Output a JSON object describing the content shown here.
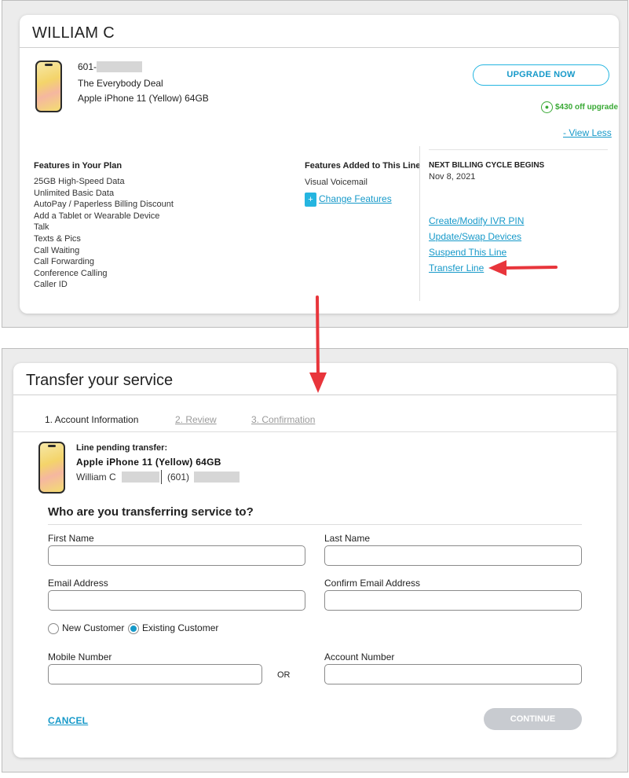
{
  "line_card": {
    "owner_name": "WILLIAM C",
    "line_number_prefix": "601-",
    "plan_name": "The Everybody Deal",
    "device": "Apple iPhone 11 (Yellow) 64GB",
    "upgrade_button": "UPGRADE NOW",
    "promo_badge": "$430 off upgrade",
    "view_less_link": "- View Less",
    "features_in_plan_heading": "Features in Your Plan",
    "features_in_plan": [
      "25GB High-Speed Data",
      "Unlimited Basic Data",
      "AutoPay / Paperless Billing Discount",
      "Add a Tablet or Wearable Device",
      "Talk",
      "Texts & Pics",
      "Call Waiting",
      "Call Forwarding",
      "Conference Calling",
      "Caller ID"
    ],
    "features_added_heading": "Features Added to This Line",
    "features_added": [
      "Visual Voicemail"
    ],
    "change_features_link": "Change Features",
    "change_features_plus": "+",
    "billing_label": "NEXT BILLING CYCLE BEGINS",
    "billing_date": "Nov 8, 2021",
    "actions": [
      "Create/Modify IVR PIN",
      "Update/Swap Devices",
      "Suspend This Line",
      "Transfer Line"
    ]
  },
  "transfer_card": {
    "title": "Transfer your service",
    "steps": [
      {
        "label": "1. Account Information",
        "active": true
      },
      {
        "label": "2. Review",
        "active": false
      },
      {
        "label": "3. Confirmation",
        "active": false
      }
    ],
    "pending_label": "Line pending transfer:",
    "pending_device": "Apple iPhone 11 (Yellow) 64GB",
    "pending_owner": "William C",
    "pending_area_code": "(601)",
    "question": "Who are you transferring service to?",
    "fields": {
      "first_name": {
        "label": "First Name",
        "value": ""
      },
      "last_name": {
        "label": "Last Name",
        "value": ""
      },
      "email": {
        "label": "Email Address",
        "value": ""
      },
      "confirm_email": {
        "label": "Confirm Email Address",
        "value": ""
      },
      "mobile_number": {
        "label": "Mobile Number",
        "value": ""
      },
      "account_number": {
        "label": "Account Number",
        "value": ""
      }
    },
    "customer_type": {
      "options": [
        "New Customer",
        "Existing Customer"
      ],
      "selected": "Existing Customer"
    },
    "or_label": "OR",
    "cancel_link": "CANCEL",
    "continue_button": "CONTINUE",
    "continue_enabled": false
  },
  "colors": {
    "accent": "#1699c9",
    "annotation_arrow": "#e8353b",
    "promo_green": "#39a935",
    "disabled_button": "#c8cbd0"
  }
}
